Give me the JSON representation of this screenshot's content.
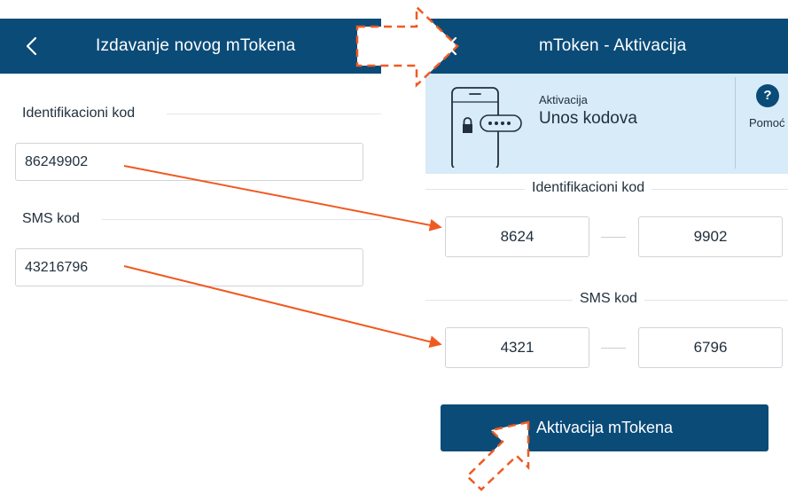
{
  "left_screen": {
    "title": "Izdavanje novog mTokena",
    "identification": {
      "label": "Identifikacioni kod",
      "value": "86249902"
    },
    "sms": {
      "label": "SMS kod",
      "value": "43216796"
    }
  },
  "right_screen": {
    "title": "mToken - Aktivacija",
    "banner": {
      "subtitle": "Aktivacija",
      "title": "Unos kodova",
      "help_label": "Pomoć",
      "help_symbol": "?"
    },
    "identification": {
      "label": "Identifikacioni kod",
      "part1": "8624",
      "part2": "9902"
    },
    "sms": {
      "label": "SMS kod",
      "part1": "4321",
      "part2": "6796"
    },
    "activate_button": "Aktivacija mTokena"
  },
  "colors": {
    "header_blue": "#0b4b78",
    "banner_blue": "#d7ebf8",
    "annotation_orange": "#f05a22"
  }
}
